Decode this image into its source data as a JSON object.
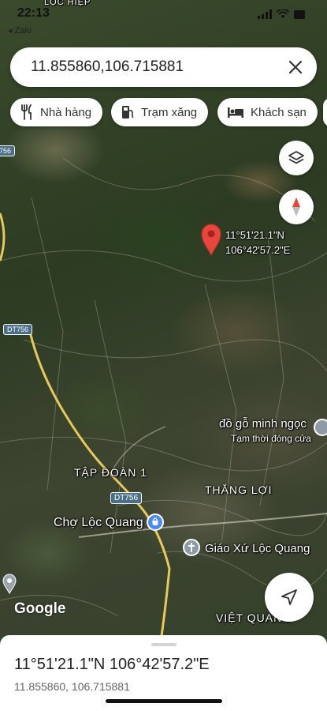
{
  "status_bar": {
    "time": "22:13",
    "back_app": "◂ Zalo"
  },
  "search": {
    "value": "11.855860,106.715881"
  },
  "chips": [
    {
      "label": "Nhà hàng",
      "icon": "restaurant-icon"
    },
    {
      "label": "Trạm xăng",
      "icon": "gas-station-icon"
    },
    {
      "label": "Khách sạn",
      "icon": "hotel-icon"
    }
  ],
  "map": {
    "pin_label_lat": "11°51'21.1\"N",
    "pin_label_lng": "106°42'57.2\"E",
    "labels": {
      "loc_hiep": "LỘC HIỆP",
      "road_dt756_left": "DT756",
      "road_dt756_main": "DT756",
      "road_dt756_top": "756",
      "tap_doan": "TẬP ĐOÀN 1",
      "thang_loi": "THẮNG LỢI",
      "cho_loc_quang": "Chợ Lộc Quang",
      "giao_xu": "Giáo Xứ Lộc Quang",
      "do_go": "đồ gỗ minh ngọc",
      "do_go_status": "Tạm thời đóng cửa",
      "viet_quang": "VIỆT QUANG",
      "google": "Google"
    },
    "colors": {
      "pin": "#e8453c",
      "market_icon": "#4a8af4",
      "road": "#e6c95a"
    }
  },
  "sheet": {
    "title": "11°51'21.1\"N 106°42'57.2\"E",
    "subtitle": "11.855860, 106.715881"
  }
}
